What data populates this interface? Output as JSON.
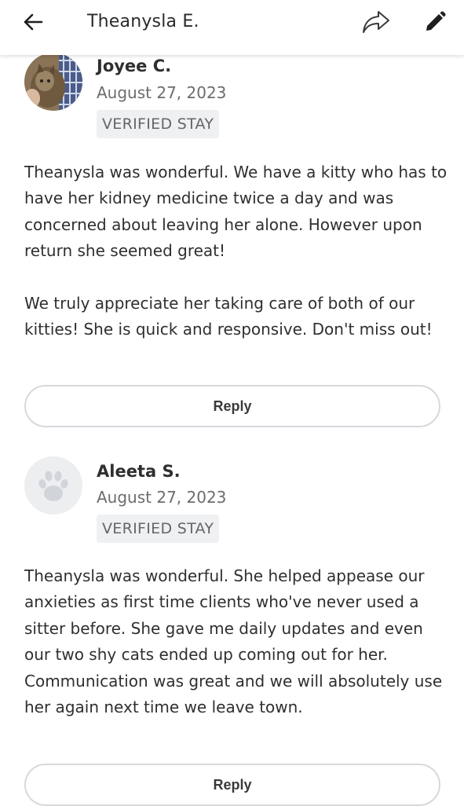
{
  "header": {
    "title": "Theanysla E.",
    "back_icon": "arrow-left-icon",
    "share_icon": "share-icon",
    "edit_icon": "pencil-icon"
  },
  "reviews": [
    {
      "name": "Joyee C.",
      "date": "August 27, 2023",
      "badge": "VERIFIED STAY",
      "avatar": "cat-photo",
      "paragraphs": [
        "Theanysla was wonderful. We have a kitty who has to have her kidney medicine twice a day and was concerned about leaving her alone. However upon return she seemed great!",
        "We truly appreciate her taking care of both of our kitties! She is quick and responsive. Don't miss out!"
      ],
      "reply_label": "Reply"
    },
    {
      "name": "Aleeta S.",
      "date": "August 27, 2023",
      "badge": "VERIFIED STAY",
      "avatar": "paw-icon",
      "paragraphs": [
        "Theanysla was wonderful. She helped appease our anxieties as first time clients who've never used a sitter before. She gave me daily  updates and even our two shy cats ended up coming out for her. Communication was great and we will absolutely use her again next time we leave town."
      ],
      "reply_label": "Reply"
    }
  ]
}
